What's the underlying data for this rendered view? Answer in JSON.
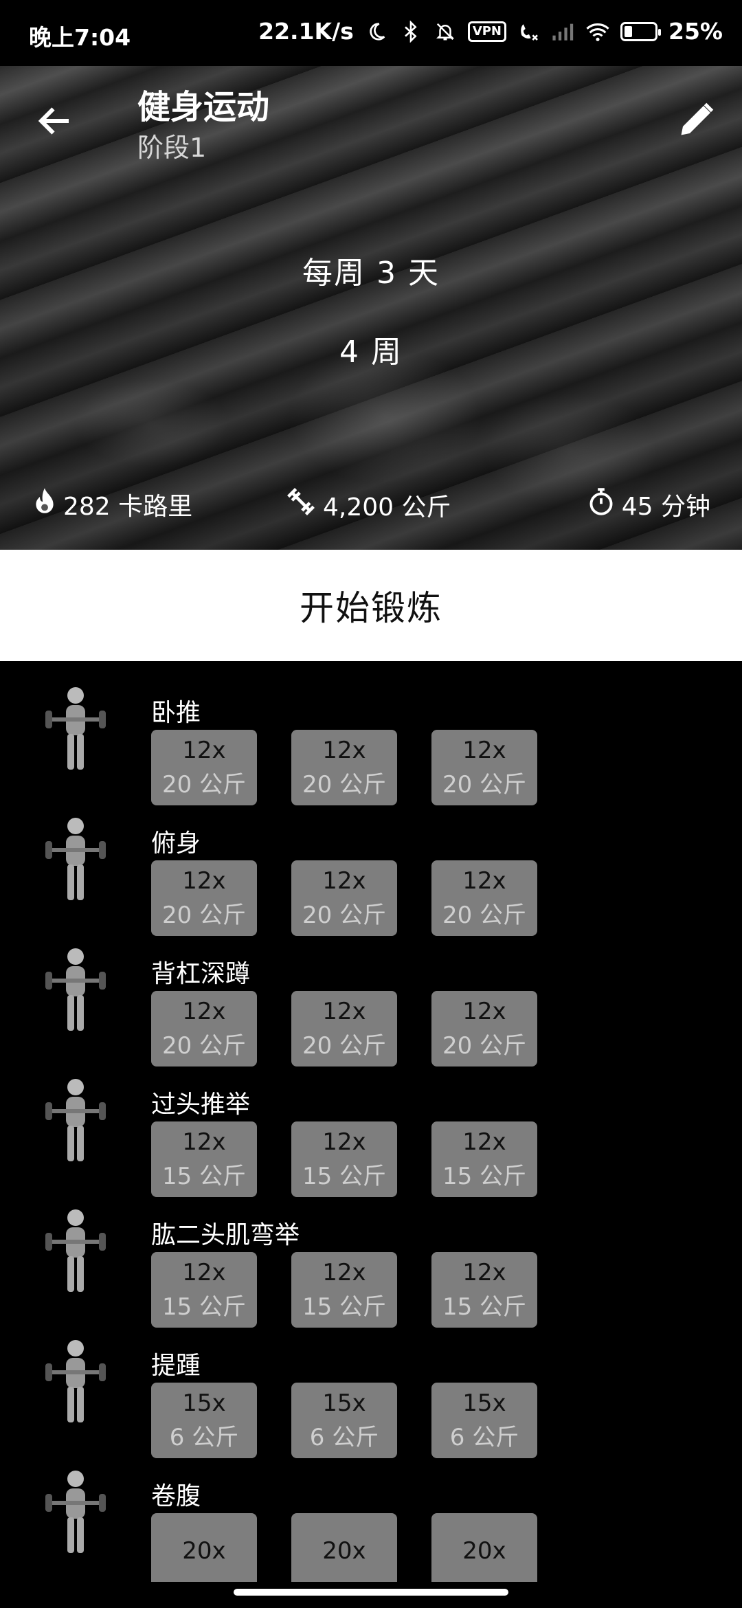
{
  "status_bar": {
    "time": "晚上7:04",
    "speed": "22.1K/s",
    "vpn": "VPN",
    "battery": "25%",
    "battery_level": 0.25,
    "icons": [
      "moon-icon",
      "bluetooth-icon",
      "bell-off-icon",
      "vpn-icon",
      "call-icon",
      "signal-icon",
      "wifi-icon",
      "battery-icon"
    ]
  },
  "header": {
    "title": "健身运动",
    "subtitle": "阶段1",
    "days_per_week": "每周 3 天",
    "weeks": "4 周",
    "stats": {
      "calories": "282 卡路里",
      "weight": "4,200 公斤",
      "duration": "45 分钟"
    }
  },
  "start_button": "开始锻炼",
  "exercises": [
    {
      "name": "卧推",
      "sets": [
        {
          "reps": "12x",
          "weight": "20 公斤"
        },
        {
          "reps": "12x",
          "weight": "20 公斤"
        },
        {
          "reps": "12x",
          "weight": "20 公斤"
        }
      ]
    },
    {
      "name": "俯身",
      "sets": [
        {
          "reps": "12x",
          "weight": "20 公斤"
        },
        {
          "reps": "12x",
          "weight": "20 公斤"
        },
        {
          "reps": "12x",
          "weight": "20 公斤"
        }
      ]
    },
    {
      "name": "背杠深蹲",
      "sets": [
        {
          "reps": "12x",
          "weight": "20 公斤"
        },
        {
          "reps": "12x",
          "weight": "20 公斤"
        },
        {
          "reps": "12x",
          "weight": "20 公斤"
        }
      ]
    },
    {
      "name": "过头推举",
      "sets": [
        {
          "reps": "12x",
          "weight": "15 公斤"
        },
        {
          "reps": "12x",
          "weight": "15 公斤"
        },
        {
          "reps": "12x",
          "weight": "15 公斤"
        }
      ]
    },
    {
      "name": "肱二头肌弯举",
      "sets": [
        {
          "reps": "12x",
          "weight": "15 公斤"
        },
        {
          "reps": "12x",
          "weight": "15 公斤"
        },
        {
          "reps": "12x",
          "weight": "15 公斤"
        }
      ]
    },
    {
      "name": "提踵",
      "sets": [
        {
          "reps": "15x",
          "weight": "6 公斤"
        },
        {
          "reps": "15x",
          "weight": "6 公斤"
        },
        {
          "reps": "15x",
          "weight": "6 公斤"
        }
      ]
    },
    {
      "name": "卷腹",
      "sets": [
        {
          "reps": "20x",
          "weight": ""
        },
        {
          "reps": "20x",
          "weight": ""
        },
        {
          "reps": "20x",
          "weight": ""
        }
      ]
    }
  ]
}
